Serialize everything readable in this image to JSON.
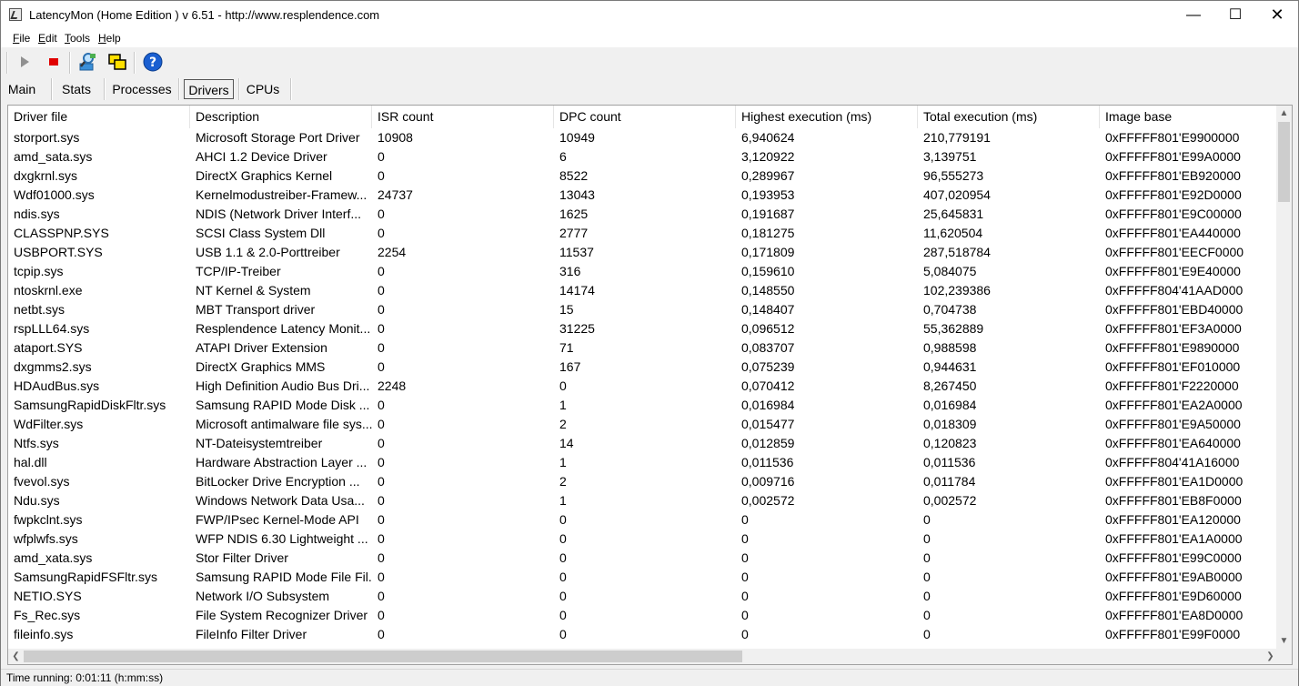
{
  "window": {
    "title": "LatencyMon  (Home Edition )  v 6.51 - http://www.resplendence.com",
    "minimize_glyph": "—",
    "maximize_glyph": "☐",
    "close_glyph": "✕"
  },
  "menu": [
    {
      "mnemonic": "F",
      "rest": "ile"
    },
    {
      "mnemonic": "E",
      "rest": "dit"
    },
    {
      "mnemonic": "T",
      "rest": "ools"
    },
    {
      "mnemonic": "H",
      "rest": "elp"
    }
  ],
  "toolbar": {
    "icons": [
      "play-icon",
      "stop-icon",
      "network-search-icon",
      "windows-icon",
      "help-icon"
    ],
    "colors": {
      "stop": "#e00000",
      "help": "#1a5fd1"
    }
  },
  "tabs": [
    {
      "label": "Main",
      "active": false
    },
    {
      "label": "Stats",
      "active": false
    },
    {
      "label": "Processes",
      "active": false
    },
    {
      "label": "Drivers",
      "active": true
    },
    {
      "label": "CPUs",
      "active": false
    }
  ],
  "table": {
    "headers": [
      "Driver file",
      "Description",
      "ISR count",
      "DPC count",
      "Highest execution (ms)",
      "Total execution (ms)",
      "Image base"
    ],
    "rows": [
      [
        "storport.sys",
        "Microsoft Storage Port Driver",
        "10908",
        "10949",
        "6,940624",
        "210,779191",
        "0xFFFFF801'E9900000"
      ],
      [
        "amd_sata.sys",
        "AHCI 1.2 Device Driver",
        "0",
        "6",
        "3,120922",
        "3,139751",
        "0xFFFFF801'E99A0000"
      ],
      [
        "dxgkrnl.sys",
        "DirectX Graphics Kernel",
        "0",
        "8522",
        "0,289967",
        "96,555273",
        "0xFFFFF801'EB920000"
      ],
      [
        "Wdf01000.sys",
        "Kernelmodustreiber-Framew...",
        "24737",
        "13043",
        "0,193953",
        "407,020954",
        "0xFFFFF801'E92D0000"
      ],
      [
        "ndis.sys",
        "NDIS (Network Driver Interf...",
        "0",
        "1625",
        "0,191687",
        "25,645831",
        "0xFFFFF801'E9C00000"
      ],
      [
        "CLASSPNP.SYS",
        "SCSI Class System Dll",
        "0",
        "2777",
        "0,181275",
        "11,620504",
        "0xFFFFF801'EA440000"
      ],
      [
        "USBPORT.SYS",
        "USB 1.1 & 2.0-Porttreiber",
        "2254",
        "11537",
        "0,171809",
        "287,518784",
        "0xFFFFF801'EECF0000"
      ],
      [
        "tcpip.sys",
        "TCP/IP-Treiber",
        "0",
        "316",
        "0,159610",
        "5,084075",
        "0xFFFFF801'E9E40000"
      ],
      [
        "ntoskrnl.exe",
        "NT Kernel & System",
        "0",
        "14174",
        "0,148550",
        "102,239386",
        "0xFFFFF804'41AAD000"
      ],
      [
        "netbt.sys",
        "MBT Transport driver",
        "0",
        "15",
        "0,148407",
        "0,704738",
        "0xFFFFF801'EBD40000"
      ],
      [
        "rspLLL64.sys",
        "Resplendence Latency Monit...",
        "0",
        "31225",
        "0,096512",
        "55,362889",
        "0xFFFFF801'EF3A0000"
      ],
      [
        "ataport.SYS",
        "ATAPI Driver Extension",
        "0",
        "71",
        "0,083707",
        "0,988598",
        "0xFFFFF801'E9890000"
      ],
      [
        "dxgmms2.sys",
        "DirectX Graphics MMS",
        "0",
        "167",
        "0,075239",
        "0,944631",
        "0xFFFFF801'EF010000"
      ],
      [
        "HDAudBus.sys",
        "High Definition Audio Bus Dri...",
        "2248",
        "0",
        "0,070412",
        "8,267450",
        "0xFFFFF801'F2220000"
      ],
      [
        "SamsungRapidDiskFltr.sys",
        "Samsung RAPID Mode Disk ...",
        "0",
        "1",
        "0,016984",
        "0,016984",
        "0xFFFFF801'EA2A0000"
      ],
      [
        "WdFilter.sys",
        "Microsoft antimalware file sys...",
        "0",
        "2",
        "0,015477",
        "0,018309",
        "0xFFFFF801'E9A50000"
      ],
      [
        "Ntfs.sys",
        "NT-Dateisystemtreiber",
        "0",
        "14",
        "0,012859",
        "0,120823",
        "0xFFFFF801'EA640000"
      ],
      [
        "hal.dll",
        "Hardware Abstraction Layer ...",
        "0",
        "1",
        "0,011536",
        "0,011536",
        "0xFFFFF804'41A16000"
      ],
      [
        "fvevol.sys",
        "BitLocker Drive Encryption ...",
        "0",
        "2",
        "0,009716",
        "0,011784",
        "0xFFFFF801'EA1D0000"
      ],
      [
        "Ndu.sys",
        "Windows Network Data Usa...",
        "0",
        "1",
        "0,002572",
        "0,002572",
        "0xFFFFF801'EB8F0000"
      ],
      [
        "fwpkclnt.sys",
        "FWP/IPsec Kernel-Mode API",
        "0",
        "0",
        "0",
        "0",
        "0xFFFFF801'EA120000"
      ],
      [
        "wfplwfs.sys",
        "WFP NDIS 6.30 Lightweight ...",
        "0",
        "0",
        "0",
        "0",
        "0xFFFFF801'EA1A0000"
      ],
      [
        "amd_xata.sys",
        "Stor Filter Driver",
        "0",
        "0",
        "0",
        "0",
        "0xFFFFF801'E99C0000"
      ],
      [
        "SamsungRapidFSFltr.sys",
        "Samsung RAPID Mode File Fil...",
        "0",
        "0",
        "0",
        "0",
        "0xFFFFF801'E9AB0000"
      ],
      [
        "NETIO.SYS",
        "Network I/O Subsystem",
        "0",
        "0",
        "0",
        "0",
        "0xFFFFF801'E9D60000"
      ],
      [
        "Fs_Rec.sys",
        "File System Recognizer Driver",
        "0",
        "0",
        "0",
        "0",
        "0xFFFFF801'EA8D0000"
      ],
      [
        "fileinfo.sys",
        "FileInfo Filter Driver",
        "0",
        "0",
        "0",
        "0",
        "0xFFFFF801'E99F0000"
      ]
    ]
  },
  "scroll": {
    "up": "▲",
    "down": "▼",
    "left": "❮",
    "right": "❯"
  },
  "status": {
    "text": "Time running: 0:01:11  (h:mm:ss)"
  }
}
